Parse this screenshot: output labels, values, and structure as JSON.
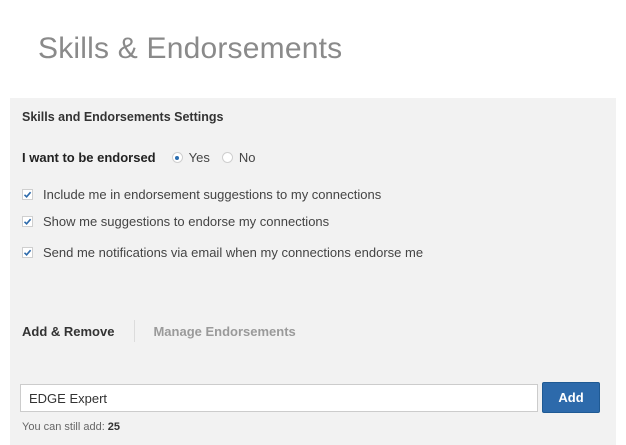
{
  "page": {
    "title": "Skills & Endorsements"
  },
  "settings": {
    "heading": "Skills and Endorsements Settings",
    "endorsed": {
      "label": "I want to be endorsed",
      "options": [
        {
          "label": "Yes",
          "checked": true
        },
        {
          "label": "No",
          "checked": false
        }
      ]
    },
    "checkboxes": [
      {
        "label": "Include me in endorsement suggestions to my connections",
        "checked": true
      },
      {
        "label": "Show me suggestions to endorse my connections",
        "checked": true
      },
      {
        "label": "Send me notifications via email when my connections endorse me",
        "checked": true
      }
    ]
  },
  "tabs": [
    {
      "label": "Add & Remove",
      "active": true
    },
    {
      "label": "Manage Endorsements",
      "active": false
    }
  ],
  "add_skill": {
    "input_value": "EDGE Expert",
    "button_label": "Add",
    "remaining_label": "You can still add:",
    "remaining_count": "25"
  },
  "colors": {
    "accent": "#2d6aab",
    "panel_background": "#f2f2f2",
    "title": "#8a8a8a"
  }
}
